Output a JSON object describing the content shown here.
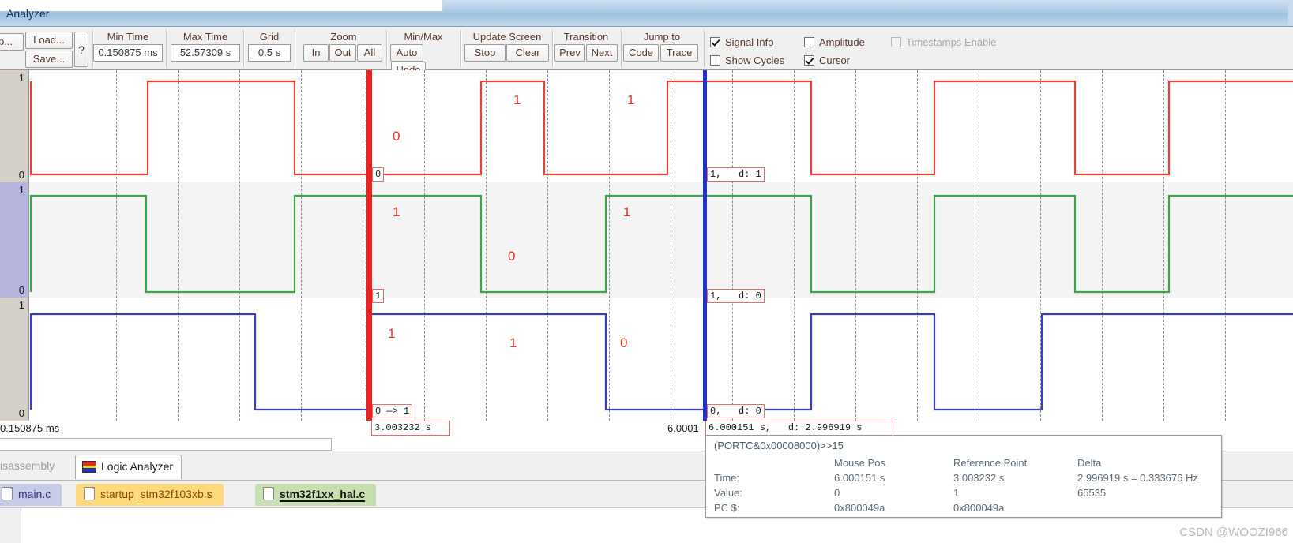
{
  "window": {
    "title": "Analyzer"
  },
  "toolbar": {
    "setup_button": "p...",
    "load_button": "Load...",
    "save_button": "Save...",
    "help_button": "?",
    "groups": [
      {
        "caption": "Min Time",
        "value": "0.150875 ms"
      },
      {
        "caption": "Max Time",
        "value": "52.57309 s"
      },
      {
        "caption": "Grid",
        "value": "0.5 s"
      }
    ],
    "zoom": {
      "caption": "Zoom",
      "buttons": [
        "In",
        "Out",
        "All"
      ]
    },
    "minmax": {
      "caption": "Min/Max",
      "buttons": [
        "Auto",
        "Undo"
      ]
    },
    "update_screen": {
      "caption": "Update Screen",
      "buttons": [
        "Stop",
        "Clear"
      ]
    },
    "transition": {
      "caption": "Transition",
      "buttons": [
        "Prev",
        "Next"
      ]
    },
    "jump_to": {
      "caption": "Jump to",
      "buttons": [
        "Code",
        "Trace"
      ]
    },
    "checkboxes": [
      {
        "label": "Signal Info",
        "checked": true,
        "enabled": true
      },
      {
        "label": "Show Cycles",
        "checked": false,
        "enabled": true
      },
      {
        "label": "Amplitude",
        "checked": false,
        "enabled": true
      },
      {
        "label": "Cursor",
        "checked": true,
        "enabled": true
      },
      {
        "label": "Timestamps Enable",
        "checked": false,
        "enabled": false
      }
    ]
  },
  "plot": {
    "axis_high": "1",
    "axis_low": "0",
    "channels": [
      {
        "name": "channel-red",
        "color": "#e8413c",
        "selected": false
      },
      {
        "name": "channel-green",
        "color": "#3aa74a",
        "selected": true
      },
      {
        "name": "channel-blue",
        "color": "#3b3fb5",
        "selected": false
      }
    ],
    "cursor_red_color": "#ee2222",
    "cursor_blue_color": "#2233cc",
    "annotations_red": [
      "0",
      "1",
      "1"
    ],
    "annotations_green": [
      "1",
      "0",
      "1"
    ],
    "annotations_blue": [
      "1",
      "1",
      "0"
    ],
    "tags": {
      "red_at_red_cursor": "0",
      "green_at_red_cursor": "1",
      "blue_at_red_cursor": "0 —> 1",
      "red_at_blue_cursor": "1,   d: 1",
      "green_at_blue_cursor": "1,   d: 0",
      "blue_at_blue_cursor": "0,   d: 0"
    }
  },
  "time_axis": {
    "left_label": "0.150875 ms",
    "red_cursor_label": "3.003232 s",
    "blue_cursor_label_left": "6.0001",
    "blue_cursor_label": "6.000151 s,   d: 2.996919 s"
  },
  "view_tabs": [
    {
      "label": "isassembly",
      "active": false,
      "icon": ""
    },
    {
      "label": "Logic Analyzer",
      "active": true,
      "icon": "logic-analyzer-icon"
    }
  ],
  "file_tabs": [
    {
      "label": "main.c",
      "color": "blue",
      "active": false
    },
    {
      "label": "startup_stm32f103xb.s",
      "color": "yellow",
      "active": false
    },
    {
      "label": "stm32f1xx_hal.c",
      "color": "green",
      "active": true
    }
  ],
  "info_panel": {
    "expression": "(PORTC&0x00008000)>>15",
    "columns": [
      "",
      "Mouse Pos",
      "Reference Point",
      "Delta"
    ],
    "rows": [
      {
        "label": "Time:",
        "mouse": "6.000151 s",
        "reference": "3.003232 s",
        "delta": "2.996919 s = 0.333676 Hz"
      },
      {
        "label": "Value:",
        "mouse": "0",
        "reference": "1",
        "delta": "65535"
      },
      {
        "label": "PC $:",
        "mouse": "0x800049a",
        "reference": "0x800049a",
        "delta": ""
      }
    ]
  },
  "watermark": "CSDN @WOOZI966"
}
